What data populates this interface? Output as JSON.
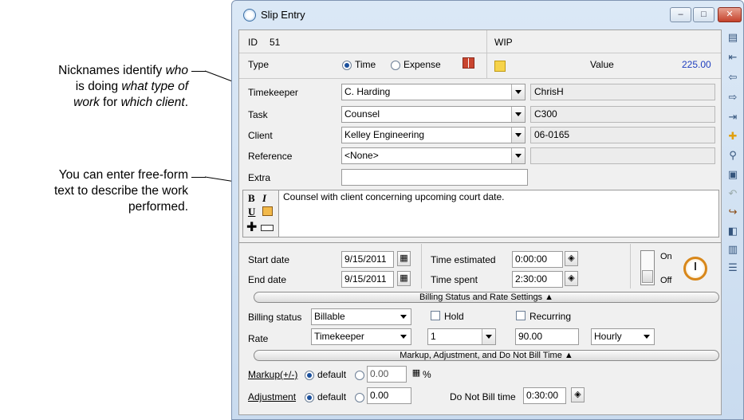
{
  "annotations": {
    "nicknames": {
      "p1": "Nicknames identify ",
      "w1": "who",
      "p2": "is doing ",
      "w2": "what type of",
      "w3": "work",
      "p3": " for ",
      "w4": "which client",
      "p4": "."
    },
    "freeform": {
      "l1": "You can enter free-form",
      "l2": "text to describe the work",
      "l3": "performed."
    }
  },
  "window": {
    "title": "Slip Entry",
    "minimize": "–",
    "maximize": "□",
    "close": "✕"
  },
  "header": {
    "id_label": "ID",
    "id_value": "51",
    "wip_label": "WIP",
    "type_label": "Type",
    "type_time": "Time",
    "type_expense": "Expense",
    "value_label": "Value",
    "value": "225.00"
  },
  "fields": {
    "timekeeper": {
      "label": "Timekeeper",
      "value": "C. Harding",
      "code": "ChrisH"
    },
    "task": {
      "label": "Task",
      "value": "Counsel",
      "code": "C300"
    },
    "client": {
      "label": "Client",
      "value": "Kelley Engineering",
      "code": "06-0165"
    },
    "reference": {
      "label": "Reference",
      "value": "<None>",
      "code": ""
    },
    "extra": {
      "label": "Extra",
      "value": ""
    }
  },
  "description": {
    "text": "Counsel with client concerning upcoming court date.",
    "bold": "B",
    "italic": "I",
    "underline": "U"
  },
  "dates": {
    "start_label": "Start date",
    "start": "9/15/2011",
    "end_label": "End date",
    "end": "9/15/2011",
    "est_label": "Time estimated",
    "est": "0:00:00",
    "spent_label": "Time spent",
    "spent": "2:30:00",
    "on": "On",
    "off": "Off"
  },
  "billing": {
    "section": "Billing Status and Rate Settings ▲",
    "status_label": "Billing status",
    "status": "Billable",
    "hold": "Hold",
    "recurring": "Recurring",
    "rate_label": "Rate",
    "rate_source": "Timekeeper",
    "rate_level": "1",
    "rate_value": "90.00",
    "rate_unit": "Hourly"
  },
  "markup": {
    "section": "Markup, Adjustment, and Do Not Bill Time ▲",
    "markup_label": "Markup(+/-)",
    "default1": "default",
    "markup_value": "0.00",
    "pct": "%",
    "adj_label": "Adjustment",
    "default2": "default",
    "adj_value": "0.00",
    "dnb_label": "Do Not Bill time",
    "dnb_value": "0:30:00"
  },
  "icons": [
    "notes-icon",
    "first-icon",
    "previous-icon",
    "next-icon",
    "last-icon",
    "add-icon",
    "find-icon",
    "save-icon",
    "undo-icon",
    "delete-icon",
    "preview-icon",
    "report-icon",
    "list-icon"
  ]
}
